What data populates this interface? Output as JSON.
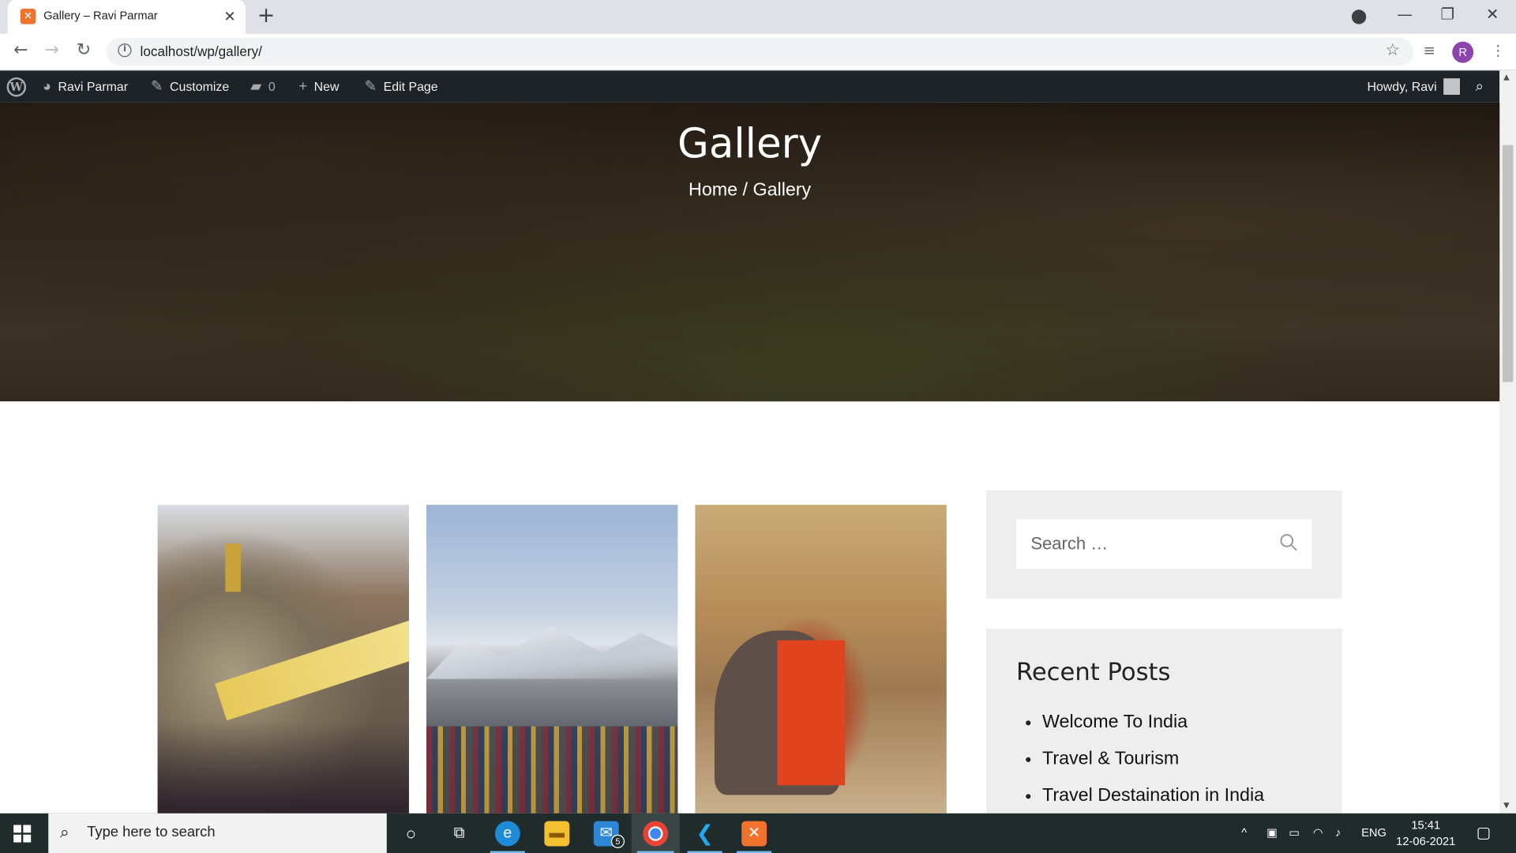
{
  "browser": {
    "tab_title": "Gallery – Ravi Parmar",
    "url": "localhost/wp/gallery/",
    "profile_initial": "R"
  },
  "adminbar": {
    "site_name": "Ravi Parmar",
    "customize": "Customize",
    "comments_count": "0",
    "new_label": "New",
    "edit_page": "Edit Page",
    "howdy": "Howdy, Ravi"
  },
  "hero": {
    "title": "Gallery",
    "breadcrumb_home": "Home",
    "breadcrumb_sep": "/",
    "breadcrumb_current": "Gallery"
  },
  "sidebar": {
    "search_placeholder": "Search …",
    "recent_title": "Recent Posts",
    "recent_posts": [
      "Welcome To India",
      "Travel & Tourism",
      "Travel Destaination in India"
    ]
  },
  "taskbar": {
    "search_placeholder": "Type here to search",
    "mail_badge": "5",
    "lang": "ENG",
    "time": "15:41",
    "date": "12-06-2021"
  },
  "colors": {
    "adminbar": "#1d2327",
    "widget_bg": "#eeeeee",
    "taskbar": "#202b2b"
  }
}
